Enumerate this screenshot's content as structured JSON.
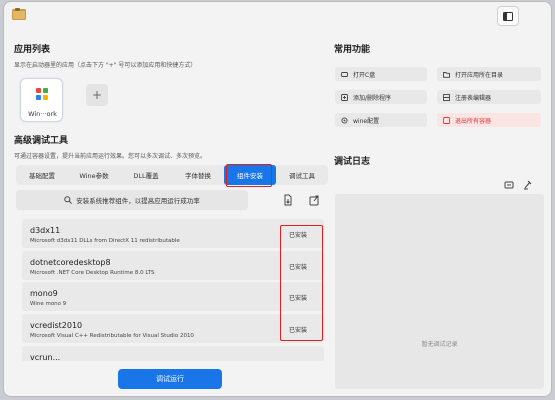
{
  "window": {
    "app_icon": "folder-icon",
    "sidebar_toggle_icon": "sidebar-toggle-icon"
  },
  "apps": {
    "title": "应用列表",
    "subtitle": "显示在启动器里的应用（点击下方 \"+\" 号可以添加应用和快捷方式）",
    "items": [
      {
        "label": "Win···ork",
        "icon": "app-grid-icon"
      }
    ],
    "add_label": "+"
  },
  "advanced": {
    "title": "高级调试工具",
    "subtitle": "可通过容器设置，提升当前应用运行效果。您可以多次调试、多次预览。",
    "tabs": [
      "基础配置",
      "Wine参数",
      "DLL覆盖",
      "字体替换",
      "组件安装",
      "调试工具"
    ],
    "active_tab": "组件安装",
    "search_label": "安装系统推荐组件，以提高应用运行成功率",
    "components": [
      {
        "name": "d3dx11",
        "desc": "Microsoft d3dx11 DLLs from DirectX 11 redistributable",
        "status": "已安装"
      },
      {
        "name": "dotnetcoredesktop8",
        "desc": "Microsoft .NET Core Desktop Runtime 8.0 LTS",
        "status": "已安装"
      },
      {
        "name": "mono9",
        "desc": "Wine mono 9",
        "status": "已安装"
      },
      {
        "name": "vcredist2010",
        "desc": "Microsoft Visual C++ Redistributable for Visual Studio 2010",
        "status": "已安装"
      },
      {
        "name": "vcrun...",
        "desc": "",
        "status": ""
      }
    ],
    "run_label": "调试运行"
  },
  "common": {
    "title": "常用功能",
    "buttons": [
      {
        "label": "打开C盘",
        "icon": "drive-icon"
      },
      {
        "label": "打开应用所在目录",
        "icon": "folder-open-icon"
      },
      {
        "label": "添加/删除程序",
        "icon": "programs-icon"
      },
      {
        "label": "注册表编辑器",
        "icon": "registry-icon"
      },
      {
        "label": "wine配置",
        "icon": "wine-config-icon"
      },
      {
        "label": "退出所有容器",
        "icon": "exit-icon"
      }
    ]
  },
  "log": {
    "title": "调试日志",
    "empty_text": "暂无调试记录"
  },
  "colors": {
    "accent": "#1876e8",
    "highlight": "#e02020",
    "danger": "#e03838"
  }
}
